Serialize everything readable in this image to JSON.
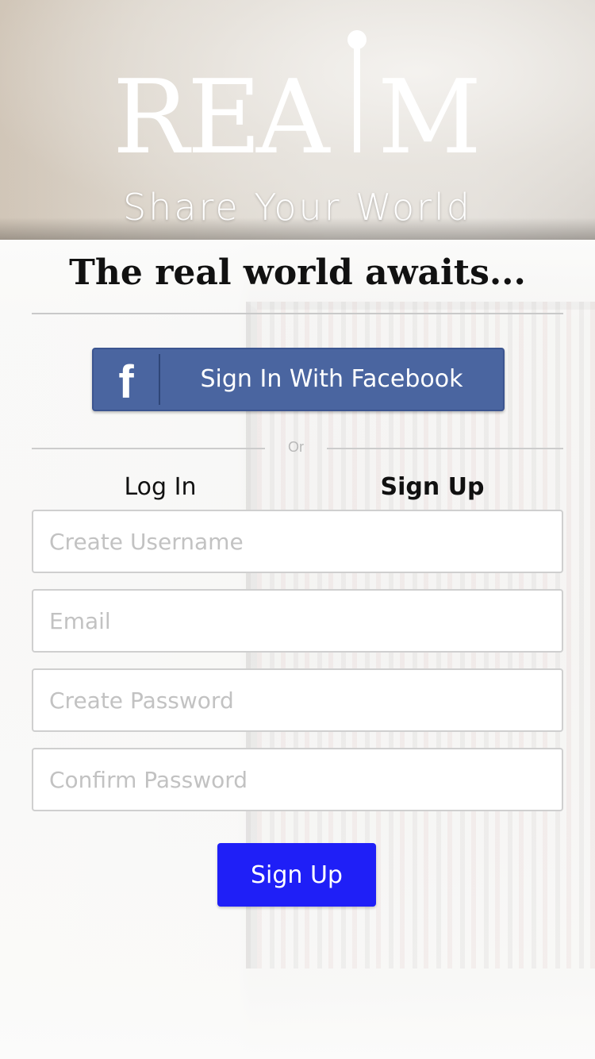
{
  "header": {
    "logo_text": "REALM",
    "tagline": "Share Your World"
  },
  "headline": "The real world awaits...",
  "facebook": {
    "icon": "facebook-f-icon",
    "label": "Sign In With Facebook",
    "color": "#4a65a0"
  },
  "separator": {
    "label": "Or"
  },
  "tabs": {
    "login": "Log In",
    "signup": "Sign Up",
    "active": "signup"
  },
  "form": {
    "username": {
      "placeholder": "Create Username",
      "value": ""
    },
    "email": {
      "placeholder": "Email",
      "value": ""
    },
    "password": {
      "placeholder": "Create Password",
      "value": ""
    },
    "confirm_password": {
      "placeholder": "Confirm Password",
      "value": ""
    }
  },
  "submit": {
    "label": "Sign Up",
    "color": "#1f1ff7"
  }
}
